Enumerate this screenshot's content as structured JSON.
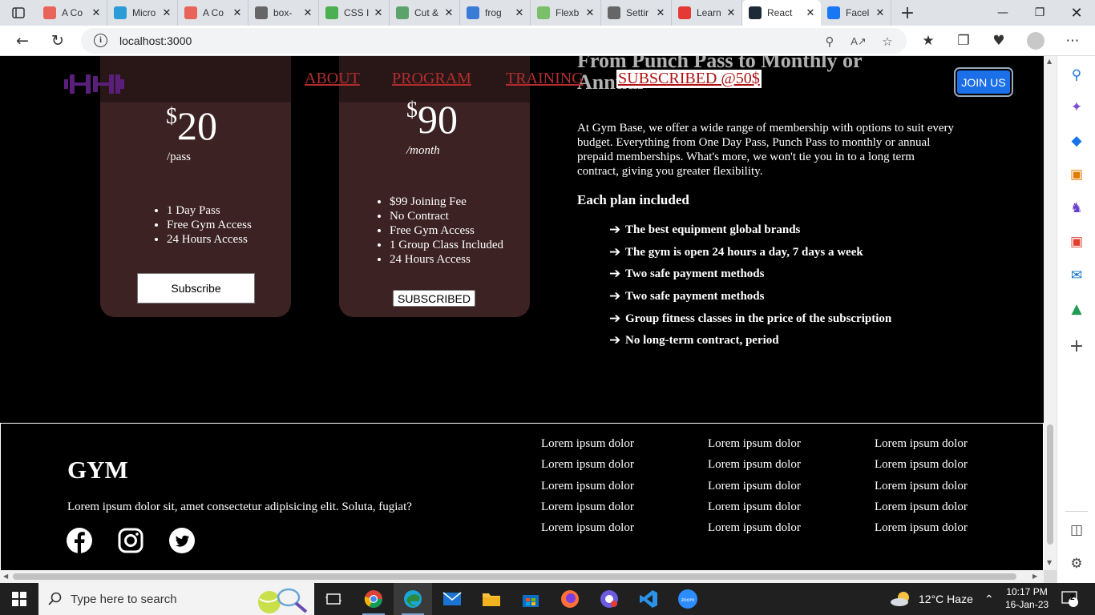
{
  "browser": {
    "tabs": [
      {
        "label": "A Co",
        "icon": "asterisk-icon",
        "color": "#e8635a"
      },
      {
        "label": "Micro",
        "icon": "edge-icon",
        "color": "#2d9bd6"
      },
      {
        "label": "A Co",
        "icon": "asterisk-icon",
        "color": "#e8635a"
      },
      {
        "label": "box-",
        "icon": "m-icon",
        "color": "#666666"
      },
      {
        "label": "CSS I",
        "icon": "w3-icon",
        "color": "#4caf50"
      },
      {
        "label": "Cut &",
        "icon": "puzzle-icon",
        "color": "#5ca36b"
      },
      {
        "label": "frog",
        "icon": "search-icon",
        "color": "#3a7bd5"
      },
      {
        "label": "Flexb",
        "icon": "frog-icon",
        "color": "#7cbf6b"
      },
      {
        "label": "Settir",
        "icon": "gear-icon",
        "color": "#666666"
      },
      {
        "label": "Learn",
        "icon": "youtube-icon",
        "color": "#e53935"
      },
      {
        "label": "React",
        "icon": "react-icon",
        "color": "#1f2a38",
        "active": true
      },
      {
        "label": "Facel",
        "icon": "facebook-icon",
        "color": "#1877f2"
      }
    ],
    "url": "localhost:3000"
  },
  "nav": {
    "links": [
      "ABOUT",
      "PROGRAM",
      "TRAINING"
    ],
    "subscribed": "SUBSCRIBED @50$",
    "join": "JOIN US"
  },
  "plans": [
    {
      "currency": "$",
      "amount": "20",
      "period": "/pass",
      "items": [
        "1 Day Pass",
        "Free Gym Access",
        "24 Hours Access"
      ],
      "button": "Subscribe"
    },
    {
      "currency": "$",
      "amount": "90",
      "period": "/month",
      "items": [
        "$99 Joining Fee",
        "No Contract",
        "Free Gym Access",
        "1 Group Class Included",
        "24 Hours Access"
      ],
      "button": "SUBSCRIBED"
    }
  ],
  "info": {
    "headline_line1": "From Punch Pass to Monthly or",
    "headline_line2": "Annual",
    "paragraph": "At Gym Base, we offer a wide range of membership with options to suit every budget. Everything from One Day Pass, Punch Pass to monthly or annual prepaid memberships. What's more, we won't tie you in to a long term contract, giving you greater flexibility.",
    "subheading": "Each plan included",
    "features": [
      "The best equipment global brands",
      "The gym is open 24 hours a day, 7 days a week",
      "Two safe payment methods",
      "Two safe payment methods",
      "Group fitness classes in the price of the subscription",
      "No long-term contract, period"
    ]
  },
  "footer": {
    "title": "GYM",
    "text": "Lorem ipsum dolor sit, amet consectetur adipisicing elit. Soluta, fugiat?",
    "columns": [
      [
        "Lorem ipsum dolor",
        "Lorem ipsum dolor",
        "Lorem ipsum dolor",
        "Lorem ipsum dolor",
        "Lorem ipsum dolor"
      ],
      [
        "Lorem ipsum dolor",
        "Lorem ipsum dolor",
        "Lorem ipsum dolor",
        "Lorem ipsum dolor",
        "Lorem ipsum dolor"
      ],
      [
        "Lorem ipsum dolor",
        "Lorem ipsum dolor",
        "Lorem ipsum dolor",
        "Lorem ipsum dolor",
        "Lorem ipsum dolor"
      ]
    ],
    "social": [
      "facebook-icon",
      "instagram-icon",
      "twitter-icon"
    ]
  },
  "taskbar": {
    "search_placeholder": "Type here to search",
    "weather": "12°C  Haze",
    "time": "10:17 PM",
    "date": "16-Jan-23",
    "notifications": "2"
  },
  "colors": {
    "card": "#3c2222",
    "nav_link": "#b22d2d",
    "join": "#1b6fe8",
    "logo": "#5a1f7a"
  }
}
